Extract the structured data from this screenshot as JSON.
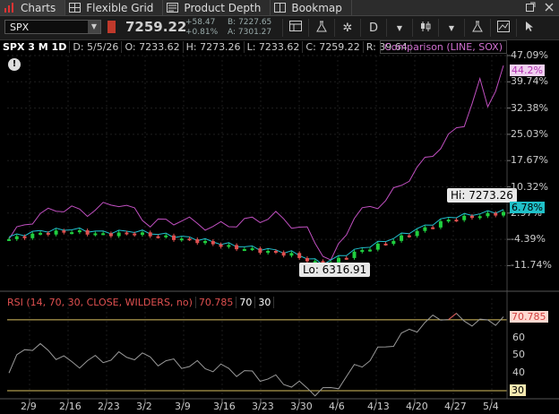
{
  "tabs": [
    {
      "label": "Charts",
      "icon": "bar-chart-icon",
      "active": true
    },
    {
      "label": "Flexible Grid",
      "icon": "grid-icon",
      "active": false
    },
    {
      "label": "Product Depth",
      "icon": "depth-icon",
      "active": false
    },
    {
      "label": "Bookmap",
      "icon": "bookmap-icon",
      "active": false
    }
  ],
  "toolbar": {
    "symbol": "SPX",
    "price": "7259.22",
    "change_abs": "+58.47",
    "change_pct": "+0.81%",
    "bid": "B: 7227.65",
    "ask": "A: 7301.27",
    "timeframe_label": "D"
  },
  "infobar": {
    "title": "SPX 3 M 1D",
    "date": "D: 5/5/26",
    "open": "O: 7233.62",
    "high": "H: 7273.26",
    "low": "L: 7233.62",
    "close": "C: 7259.22",
    "range": "R: 39.64",
    "comparison": "Comparison (LINE, SOX)"
  },
  "price_axis": {
    "labels": [
      "47.09%",
      "39.74%",
      "32.38%",
      "25.03%",
      "17.67%",
      "10.32%",
      "2.97%",
      "-4.39%",
      "-11.74%"
    ],
    "comparison_badge": "44.2%",
    "price_badge": "6.78%"
  },
  "annotations": {
    "hi": "Hi: 7273.26",
    "lo": "Lo: 6316.91"
  },
  "rsi": {
    "label": "RSI (14, 70, 30, CLOSE, WILDERS, no)",
    "value": "70.785",
    "upper": "70",
    "lower": "30",
    "axis_labels": [
      "70",
      "60",
      "50",
      "40"
    ],
    "badge_value": "70.785",
    "badge_lower": "30"
  },
  "x_axis": {
    "labels": [
      "2/9",
      "2/16",
      "2/23",
      "3/2",
      "3/9",
      "3/16",
      "3/23",
      "3/30",
      "4/6",
      "4/13",
      "4/20",
      "4/27",
      "5/4"
    ]
  },
  "colors": {
    "comparison_line": "#c04fc0",
    "price_line": "#20c0d0",
    "up_candle": "#1fcf3f",
    "down_candle": "#e05050",
    "rsi_line": "#9a9a9a",
    "rsi_level": "#d8c060"
  }
}
